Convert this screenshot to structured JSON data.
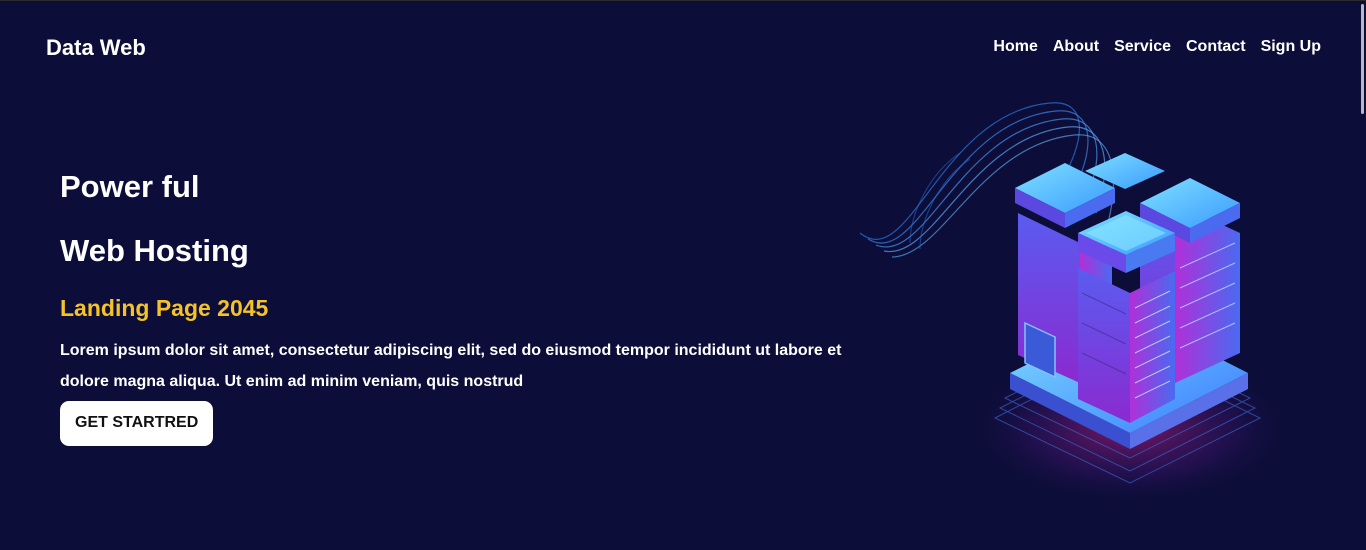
{
  "header": {
    "brand": "Data Web",
    "nav": [
      "Home",
      "About",
      "Service",
      "Contact",
      "Sign Up"
    ]
  },
  "hero": {
    "title_line1": "Power ful",
    "title_line2": "Web Hosting",
    "subtitle": "Landing Page 2045",
    "description": "Lorem ipsum dolor sit amet, consectetur adipiscing elit, sed do eiusmod tempor incididunt ut labore et dolore magna aliqua. Ut enim ad minim veniam, quis nostrud",
    "cta_label": "GET STARTRED"
  },
  "colors": {
    "background": "#0c0d38",
    "accent": "#f5c327",
    "button_bg": "#ffffff"
  },
  "illustration": {
    "icon": "isometric-server-rack-illustration"
  }
}
